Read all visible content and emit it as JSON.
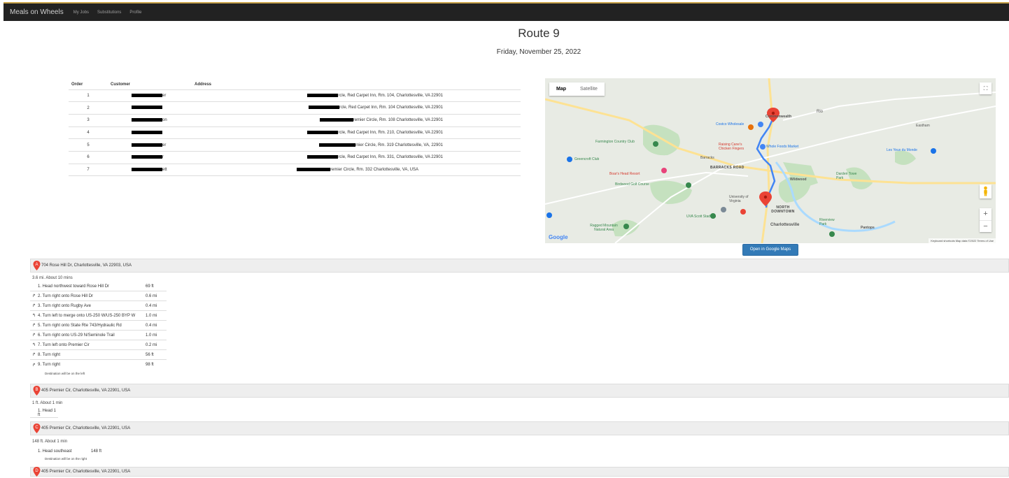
{
  "nav": {
    "brand": "Meals on Wheels",
    "links": [
      "My Jobs",
      "Substitutions",
      "Profile"
    ]
  },
  "header": {
    "title": "Route 9",
    "date": "Friday, November 25, 2022"
  },
  "orders_table": {
    "columns": [
      "Order",
      "Customer",
      "Address"
    ],
    "rows": [
      {
        "order": "1",
        "customer_tail": "er",
        "address_tail": "rcle, Red Carpet Inn, Rm. 104, Charlottesville, VA 22901"
      },
      {
        "order": "2",
        "customer_tail": "",
        "address_tail": "rcle, Red Carpet Inn, Rm. 104 Charlottesville, VA 22901"
      },
      {
        "order": "3",
        "customer_tail": "on",
        "address_tail": "remier Circle, Rm. 108 Charlottesville, VA 22901"
      },
      {
        "order": "4",
        "customer_tail": "",
        "address_tail": "rcle, Red Carpet Inn, Rm. 210, Charlottesville, VA 22901"
      },
      {
        "order": "5",
        "customer_tail": "er",
        "address_tail": "mier Circle, Rm. 319 Charlottesville, VA, 22901"
      },
      {
        "order": "6",
        "customer_tail": "r",
        "address_tail": "rcle, Red Carpet Inn, Rm. 331, Charlottesville, VA 22901"
      },
      {
        "order": "7",
        "customer_tail": "ett",
        "address_tail": "remier Circle, Rm. 332 Charlottesville, VA, USA"
      }
    ]
  },
  "map": {
    "toggle": [
      "Map",
      "Satellite"
    ],
    "google": "Google",
    "attribution": "Keyboard shortcuts   Map data ©2022   Terms of Use",
    "labels": {
      "costco": "Costco Wholesale",
      "commonwealth": "Commonwealth",
      "rio": "Rio",
      "eastham": "Eastham",
      "farmington": "Farmington Country Club",
      "raising_canes": "Raising Cane's Chicken Fingers",
      "whole_foods": "Whole Foods Market",
      "les_yeux": "Les Yeux du Monde",
      "greencroft": "Greencroft Club",
      "barracks": "Barracks",
      "barracks_road": "BARRACKS ROAD",
      "boars_head": "Boar's Head Resort",
      "birdwood": "Birdwood Golf Course",
      "university": "University of Virginia",
      "wildwood": "Wildwood",
      "darden": "Darden Towe Park",
      "north_downtown": "NORTH DOWNTOWN",
      "uva_stadium": "UVA Scott Stadium",
      "charlottesville": "Charlottesville",
      "ragged": "Ragged Mountain Natural Area",
      "riverview": "Riverview Park",
      "pantops": "Pantops"
    },
    "colors": {
      "route": "#4285f4",
      "pin": "#ea4335",
      "park": "#c5e1bf",
      "road": "#fde293",
      "water": "#aadaff"
    }
  },
  "open_button": "Open in Google Maps",
  "legs": [
    {
      "marker": "A",
      "address": "704 Rose Hill Dr, Charlottesville, VA 22903, USA",
      "summary": "3.6 mi. About 10 mins",
      "steps": [
        {
          "icon": "none",
          "text": "1. Head northwest toward Rose Hill Dr",
          "dist": "69 ft"
        },
        {
          "icon": "turn-right",
          "text": "2. Turn right onto Rose Hill Dr",
          "dist": "0.6 mi"
        },
        {
          "icon": "turn-right",
          "text": "3. Turn right onto Rugby Ave",
          "dist": "0.4 mi"
        },
        {
          "icon": "merge",
          "text": "4. Turn left to merge onto US-250 W/US-250 BYP W",
          "dist": "1.0 mi"
        },
        {
          "icon": "turn-right",
          "text": "5. Turn right onto State Rte 743/Hydraulic Rd",
          "dist": "0.4 mi"
        },
        {
          "icon": "turn-right",
          "text": "6. Turn right onto US-29 N/Seminole Trail",
          "dist": "1.0 mi"
        },
        {
          "icon": "turn-left",
          "text": "7. Turn left onto Premier Cir",
          "dist": "0.2 mi"
        },
        {
          "icon": "turn-right",
          "text": "8. Turn right",
          "dist": "56 ft"
        },
        {
          "icon": "turn-right",
          "text": "9. Turn right",
          "dist": "98 ft"
        }
      ],
      "note": "Destination will be on the left"
    },
    {
      "marker": "B",
      "address": "405 Premier Cir, Charlottesville, VA 22901, USA",
      "summary": "1 ft. About 1 min",
      "steps": [
        {
          "icon": "none",
          "text": "1. Head 1 ft",
          "dist": ""
        }
      ]
    },
    {
      "marker": "C",
      "address": "405 Premier Cir, Charlottesville, VA 22901, USA",
      "summary": "148 ft. About 1 min",
      "steps": [
        {
          "icon": "none",
          "text": "1. Head southeast",
          "dist": "148 ft"
        }
      ],
      "note": "Destination will be on the right"
    },
    {
      "marker": "D",
      "address": "405 Premier Cir, Charlottesville, VA 22901, USA"
    }
  ]
}
